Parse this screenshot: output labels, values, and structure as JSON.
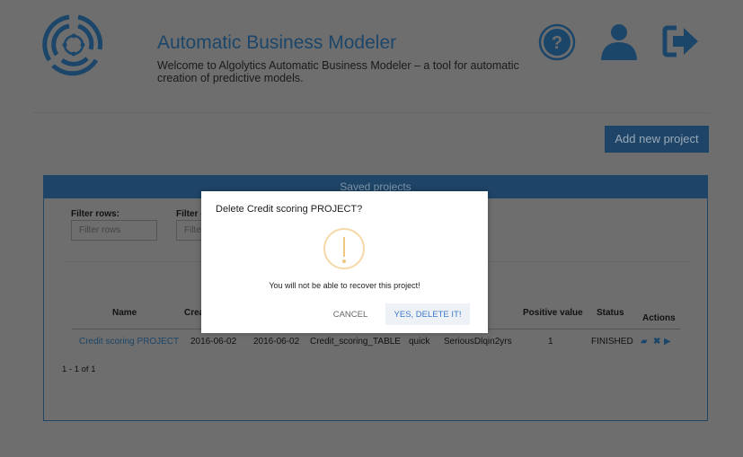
{
  "header": {
    "title": "Automatic Business Modeler",
    "subtitle": "Welcome to Algolytics Automatic Business Modeler – a tool for automatic creation of predictive models."
  },
  "icons": {
    "logo": "algolytics-logo",
    "help": "question-circle-icon",
    "user": "user-icon",
    "logout": "sign-out-icon"
  },
  "toolbar": {
    "add_label": "Add new project"
  },
  "panel": {
    "title": "Saved projects",
    "filter_rows_label": "Filter rows:",
    "filter_rows_placeholder": "Filter rows",
    "filter_cols_label": "Filter c",
    "filter_cols_placeholder": "Filte",
    "columns": [
      "Name",
      "Crea",
      "",
      "",
      "",
      "t",
      "Positive value",
      "Status",
      "Actions"
    ],
    "rows": [
      {
        "name": "Credit scoring PROJECT",
        "created": "2016-06-02",
        "modified": "2016-06-02",
        "table": "Credit_scoring_TABLE",
        "mode": "quick",
        "target": "SeriousDlqin2yrs",
        "positive": "1",
        "status": "FINISHED"
      }
    ],
    "pagination": "1 - 1 of 1"
  },
  "modal": {
    "title": "Delete Credit scoring PROJECT?",
    "text": "You will not be able to recover this project!",
    "cancel": "CANCEL",
    "confirm": "YES, DELETE IT!",
    "warning_color": "#f0c77e"
  },
  "colors": {
    "brand": "#1e4467",
    "link": "#3c7ac9"
  }
}
